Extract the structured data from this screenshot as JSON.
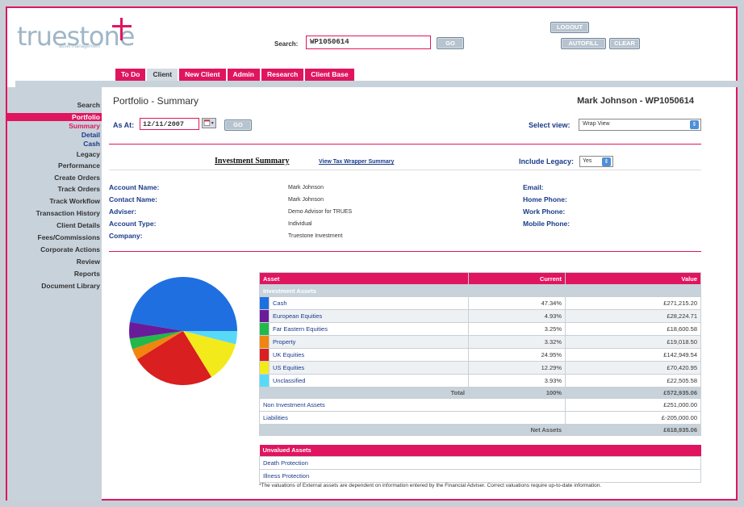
{
  "header": {
    "logo": "truestone",
    "logo_sub": "asset management",
    "search_label": "Search:",
    "search_value": "WP1050614",
    "go_label": "GO",
    "logout_label": "LOGOUT",
    "autofill_label": "AUTOFILL",
    "clear_label": "CLEAR"
  },
  "tabs": [
    "To Do",
    "Client",
    "New Client",
    "Admin",
    "Research",
    "Client Base"
  ],
  "sidebar": {
    "items": [
      "Search",
      "Portfolio",
      "Summary",
      "Detail",
      "Cash",
      "Legacy",
      "Performance",
      "Create Orders",
      "Track Orders",
      "Track Workflow",
      "Transaction History",
      "Client Details",
      "Fees/Commissions",
      "Corporate Actions",
      "Review",
      "Reports",
      "Document Library"
    ]
  },
  "main": {
    "title": "Portfolio - Summary",
    "client": "Mark Johnson - WP1050614",
    "asat_label": "As At:",
    "asat_value": "12/11/2007",
    "go_label": "GO",
    "view_label": "Select view:",
    "view_value": "Wrap View",
    "inv_summary": "Investment Summary",
    "tax_link": "View Tax Wrapper Summary",
    "legacy_label": "Include Legacy:",
    "legacy_value": "Yes"
  },
  "account": {
    "account_name_label": "Account Name:",
    "account_name": "Mark Johnson",
    "contact_name_label": "Contact Name:",
    "contact_name": "Mark Johnson",
    "adviser_label": "Adviser:",
    "adviser": "Demo Advisor for TRUES",
    "account_type_label": "Account Type:",
    "account_type": "Individual",
    "company_label": "Company:",
    "company": "Truestone Investment",
    "email_label": "Email:",
    "home_phone_label": "Home Phone:",
    "work_phone_label": "Work Phone:",
    "mobile_phone_label": "Mobile Phone:"
  },
  "table": {
    "headers": [
      "Asset",
      "Current",
      "Value"
    ],
    "subheader": "Investment Assets",
    "rows": [
      {
        "name": "Cash",
        "pct": "47.34%",
        "value": "£271,215.20",
        "color": "#1f6fe0"
      },
      {
        "name": "European Equities",
        "pct": "4.93%",
        "value": "£28,224.71",
        "color": "#6a1b9a"
      },
      {
        "name": "Far Eastern Equities",
        "pct": "3.25%",
        "value": "£18,600.58",
        "color": "#22b84a"
      },
      {
        "name": "Property",
        "pct": "3.32%",
        "value": "£19,018.50",
        "color": "#f0850f"
      },
      {
        "name": "UK Equities",
        "pct": "24.95%",
        "value": "£142,949.54",
        "color": "#d91f1f"
      },
      {
        "name": "US Equities",
        "pct": "12.29%",
        "value": "£70,420.95",
        "color": "#f3ea1c"
      },
      {
        "name": "Unclassified",
        "pct": "3.93%",
        "value": "£22,505.58",
        "color": "#58d9f7"
      }
    ],
    "total_label": "Total",
    "total_pct": "100%",
    "total_value": "£572,935.06",
    "non_investment_label": "Non Investment Assets",
    "non_investment_value": "£251,000.00",
    "liabilities_label": "Liabilities",
    "liabilities_value": "£-205,000.00",
    "net_label": "Net Assets",
    "net_value": "£618,935.06"
  },
  "unvalued": {
    "header": "Unvalued Assets",
    "rows": [
      "Death Protection",
      "Illness Protection"
    ],
    "footnote": "*The valuations of External assets are dependent on information entered by the Financial Adviser. Correct valuations require up-to-date information."
  },
  "chart_data": {
    "type": "pie",
    "categories": [
      "Cash",
      "European Equities",
      "Far Eastern Equities",
      "Property",
      "UK Equities",
      "US Equities",
      "Unclassified"
    ],
    "values": [
      47.34,
      4.93,
      3.25,
      3.32,
      24.95,
      12.29,
      3.93
    ],
    "colors": [
      "#1f6fe0",
      "#6a1b9a",
      "#22b84a",
      "#f0850f",
      "#d91f1f",
      "#f3ea1c",
      "#58d9f7"
    ]
  }
}
